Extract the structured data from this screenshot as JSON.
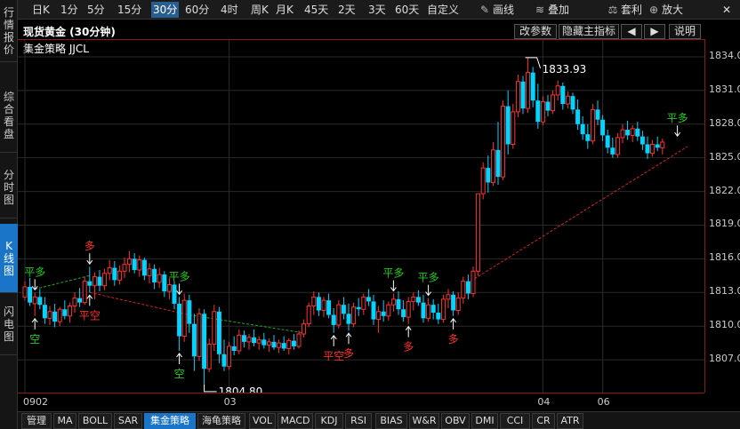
{
  "side_tabs": [
    {
      "label": "行情报价",
      "active": false
    },
    {
      "label": "综合看盘",
      "active": false
    },
    {
      "label": "分时图",
      "active": false
    },
    {
      "label": "K线图",
      "active": true
    },
    {
      "label": "闪电图",
      "active": false
    }
  ],
  "toolbar": {
    "periods": [
      "日K",
      "1分",
      "5分",
      "15分",
      "30分",
      "60分",
      "4时",
      "周K",
      "月K",
      "45天",
      "2天",
      "3天",
      "60天",
      "自定义"
    ],
    "active_period": "30分",
    "actions": [
      {
        "label": "画线",
        "icon": "pencil-icon"
      },
      {
        "label": "叠加",
        "icon": "stack-icon"
      },
      {
        "label": "套利",
        "icon": "arbitrage-icon"
      },
      {
        "label": "放大",
        "icon": "zoom-in-icon"
      }
    ],
    "close": "✕"
  },
  "header": {
    "title": "现货黄金 (30分钟)",
    "indicator": "集金策略 JJCL",
    "buttons": [
      "改参数",
      "隐藏主指标",
      "◀",
      "▶",
      "说明"
    ]
  },
  "chart_data": {
    "type": "candlestick",
    "symbol": "现货黄金",
    "interval": "30分钟",
    "y_ticks": [
      1834.0,
      1831.0,
      1828.0,
      1825.0,
      1822.0,
      1819.0,
      1816.0,
      1813.0,
      1810.0,
      1807.0
    ],
    "ylim": [
      1804.0,
      1835.5
    ],
    "x_labels": [
      {
        "label": "0902",
        "index": 0
      },
      {
        "label": "03",
        "index": 41
      },
      {
        "label": "04",
        "index": 104
      },
      {
        "label": "06",
        "index": 116
      }
    ],
    "annotations": [
      {
        "text": "1833.93",
        "index": 101,
        "value": 1833.93,
        "kind": "high"
      },
      {
        "text": "1804.80",
        "index": 36,
        "value": 1804.8,
        "kind": "low"
      }
    ],
    "signals": [
      {
        "text": "平多",
        "index": 2,
        "dir": "down",
        "color": "green"
      },
      {
        "text": "空",
        "index": 2,
        "dir": "up",
        "color": "green"
      },
      {
        "text": "多",
        "index": 13,
        "dir": "down",
        "color": "red"
      },
      {
        "text": "平空",
        "index": 13,
        "dir": "up",
        "color": "red"
      },
      {
        "text": "平多",
        "index": 31,
        "dir": "down",
        "color": "green"
      },
      {
        "text": "空",
        "index": 31,
        "dir": "up",
        "color": "green"
      },
      {
        "text": "平空",
        "index": 62,
        "dir": "up",
        "color": "red"
      },
      {
        "text": "多",
        "index": 65,
        "dir": "up",
        "color": "red"
      },
      {
        "text": "平多",
        "index": 74,
        "dir": "down",
        "color": "green"
      },
      {
        "text": "多",
        "index": 77,
        "dir": "up",
        "color": "red"
      },
      {
        "text": "平多",
        "index": 81,
        "dir": "down",
        "color": "green"
      },
      {
        "text": "多",
        "index": 86,
        "dir": "up",
        "color": "red"
      },
      {
        "text": "平多",
        "index": 131,
        "dir": "down",
        "color": "green"
      }
    ],
    "candles": [
      [
        1812.6,
        1814.0,
        1812.3,
        1813.5
      ],
      [
        1813.5,
        1814.3,
        1811.8,
        1812.1
      ],
      [
        1812.0,
        1813.0,
        1810.9,
        1812.6
      ],
      [
        1812.6,
        1813.3,
        1811.5,
        1811.9
      ],
      [
        1811.9,
        1812.6,
        1810.2,
        1810.7
      ],
      [
        1810.7,
        1811.8,
        1810.1,
        1811.3
      ],
      [
        1811.3,
        1812.0,
        1809.9,
        1810.4
      ],
      [
        1810.4,
        1811.7,
        1810.0,
        1811.5
      ],
      [
        1811.5,
        1812.3,
        1810.6,
        1810.9
      ],
      [
        1810.9,
        1812.1,
        1810.3,
        1811.8
      ],
      [
        1811.8,
        1813.0,
        1811.2,
        1812.5
      ],
      [
        1812.5,
        1813.4,
        1811.7,
        1812.1
      ],
      [
        1812.1,
        1814.4,
        1811.9,
        1814.0
      ],
      [
        1814.0,
        1815.3,
        1813.0,
        1813.6
      ],
      [
        1813.6,
        1814.8,
        1812.4,
        1814.4
      ],
      [
        1814.4,
        1815.0,
        1813.1,
        1813.6
      ],
      [
        1813.6,
        1815.1,
        1813.2,
        1814.7
      ],
      [
        1814.7,
        1815.9,
        1814.1,
        1815.2
      ],
      [
        1815.2,
        1815.8,
        1813.6,
        1814.1
      ],
      [
        1814.1,
        1815.4,
        1813.7,
        1814.9
      ],
      [
        1814.9,
        1816.1,
        1814.3,
        1815.5
      ],
      [
        1815.5,
        1816.7,
        1814.8,
        1816.0
      ],
      [
        1816.0,
        1816.5,
        1814.7,
        1815.0
      ],
      [
        1815.0,
        1816.3,
        1814.4,
        1815.9
      ],
      [
        1815.9,
        1816.1,
        1814.1,
        1814.5
      ],
      [
        1814.5,
        1815.6,
        1813.8,
        1815.1
      ],
      [
        1815.1,
        1815.5,
        1813.3,
        1813.9
      ],
      [
        1813.9,
        1815.2,
        1813.4,
        1814.6
      ],
      [
        1814.6,
        1814.9,
        1812.6,
        1813.1
      ],
      [
        1813.1,
        1814.3,
        1812.4,
        1813.7
      ],
      [
        1813.7,
        1814.0,
        1811.5,
        1812.0
      ],
      [
        1812.0,
        1812.6,
        1807.8,
        1809.1
      ],
      [
        1809.1,
        1812.9,
        1808.6,
        1812.3
      ],
      [
        1812.3,
        1812.8,
        1809.4,
        1810.2
      ],
      [
        1810.2,
        1811.1,
        1806.0,
        1807.3
      ],
      [
        1807.3,
        1811.6,
        1806.9,
        1811.1
      ],
      [
        1811.1,
        1811.5,
        1804.8,
        1806.2
      ],
      [
        1806.2,
        1808.9,
        1805.9,
        1808.4
      ],
      [
        1808.4,
        1811.9,
        1807.8,
        1811.3
      ],
      [
        1811.3,
        1811.7,
        1806.7,
        1807.5
      ],
      [
        1807.5,
        1808.8,
        1806.0,
        1806.4
      ],
      [
        1806.4,
        1808.6,
        1806.1,
        1808.2
      ],
      [
        1808.2,
        1809.1,
        1807.4,
        1807.8
      ],
      [
        1807.8,
        1809.7,
        1807.5,
        1809.2
      ],
      [
        1809.2,
        1809.6,
        1808.1,
        1808.6
      ],
      [
        1808.6,
        1809.3,
        1807.9,
        1809.0
      ],
      [
        1809.0,
        1809.7,
        1808.2,
        1808.5
      ],
      [
        1808.5,
        1809.1,
        1807.9,
        1808.8
      ],
      [
        1808.8,
        1809.4,
        1808.0,
        1808.3
      ],
      [
        1808.3,
        1808.9,
        1807.7,
        1808.6
      ],
      [
        1808.6,
        1809.2,
        1807.9,
        1808.1
      ],
      [
        1808.1,
        1808.8,
        1807.6,
        1808.5
      ],
      [
        1808.5,
        1809.1,
        1807.8,
        1808.0
      ],
      [
        1808.0,
        1808.9,
        1807.5,
        1808.7
      ],
      [
        1808.7,
        1809.3,
        1807.9,
        1808.2
      ],
      [
        1808.2,
        1809.6,
        1808.0,
        1809.3
      ],
      [
        1809.3,
        1810.6,
        1809.0,
        1810.2
      ],
      [
        1810.2,
        1812.1,
        1809.9,
        1811.8
      ],
      [
        1811.8,
        1813.1,
        1811.0,
        1812.6
      ],
      [
        1812.6,
        1813.0,
        1810.9,
        1811.4
      ],
      [
        1811.4,
        1812.6,
        1810.8,
        1812.3
      ],
      [
        1812.3,
        1812.9,
        1810.7,
        1811.0
      ],
      [
        1811.0,
        1811.6,
        1809.4,
        1810.1
      ],
      [
        1810.1,
        1812.3,
        1809.8,
        1811.9
      ],
      [
        1811.9,
        1812.6,
        1810.6,
        1811.1
      ],
      [
        1811.1,
        1812.0,
        1809.6,
        1810.2
      ],
      [
        1810.2,
        1812.1,
        1809.9,
        1811.7
      ],
      [
        1811.7,
        1812.5,
        1810.9,
        1811.5
      ],
      [
        1811.5,
        1812.9,
        1811.0,
        1812.6
      ],
      [
        1812.6,
        1813.3,
        1811.8,
        1812.2
      ],
      [
        1812.2,
        1812.8,
        1810.1,
        1810.6
      ],
      [
        1810.6,
        1811.8,
        1809.4,
        1811.3
      ],
      [
        1811.3,
        1812.3,
        1810.4,
        1810.9
      ],
      [
        1810.9,
        1812.2,
        1810.5,
        1811.9
      ],
      [
        1811.9,
        1812.9,
        1811.3,
        1812.4
      ],
      [
        1812.4,
        1813.1,
        1811.0,
        1811.5
      ],
      [
        1811.5,
        1812.3,
        1810.4,
        1810.8
      ],
      [
        1810.8,
        1812.6,
        1810.2,
        1812.2
      ],
      [
        1812.2,
        1813.0,
        1811.4,
        1812.6
      ],
      [
        1812.6,
        1813.2,
        1811.8,
        1812.1
      ],
      [
        1812.1,
        1812.8,
        1810.3,
        1810.7
      ],
      [
        1810.7,
        1812.5,
        1810.4,
        1811.9
      ],
      [
        1811.9,
        1812.4,
        1810.6,
        1811.2
      ],
      [
        1811.2,
        1812.0,
        1810.2,
        1810.6
      ],
      [
        1810.6,
        1812.8,
        1810.3,
        1812.4
      ],
      [
        1812.4,
        1813.3,
        1811.6,
        1812.8
      ],
      [
        1812.8,
        1813.1,
        1810.9,
        1811.4
      ],
      [
        1811.4,
        1813.0,
        1811.0,
        1812.5
      ],
      [
        1812.5,
        1814.4,
        1812.0,
        1814.0
      ],
      [
        1814.0,
        1814.6,
        1812.4,
        1812.9
      ],
      [
        1812.9,
        1815.3,
        1812.6,
        1814.9
      ],
      [
        1814.9,
        1819.0,
        1814.5,
        1821.8
      ],
      [
        1821.8,
        1824.6,
        1821.3,
        1824.1
      ],
      [
        1824.1,
        1825.2,
        1821.9,
        1822.8
      ],
      [
        1822.8,
        1826.4,
        1822.5,
        1825.7
      ],
      [
        1825.7,
        1828.2,
        1822.6,
        1823.3
      ],
      [
        1823.3,
        1830.1,
        1823.0,
        1829.6
      ],
      [
        1829.6,
        1831.0,
        1825.3,
        1826.2
      ],
      [
        1826.2,
        1829.8,
        1825.8,
        1829.1
      ],
      [
        1829.1,
        1832.4,
        1828.6,
        1831.8
      ],
      [
        1831.8,
        1832.3,
        1828.9,
        1829.4
      ],
      [
        1829.4,
        1833.93,
        1829.0,
        1832.6
      ],
      [
        1832.6,
        1833.1,
        1829.5,
        1830.1
      ],
      [
        1830.1,
        1831.6,
        1827.6,
        1828.2
      ],
      [
        1828.2,
        1830.5,
        1827.9,
        1830.0
      ],
      [
        1830.0,
        1830.6,
        1828.7,
        1829.2
      ],
      [
        1829.2,
        1831.0,
        1828.9,
        1830.6
      ],
      [
        1830.6,
        1831.9,
        1830.1,
        1831.4
      ],
      [
        1831.4,
        1831.7,
        1829.3,
        1829.8
      ],
      [
        1829.8,
        1830.9,
        1829.4,
        1830.5
      ],
      [
        1830.5,
        1830.8,
        1828.9,
        1829.3
      ],
      [
        1829.3,
        1830.2,
        1827.5,
        1828.0
      ],
      [
        1828.0,
        1828.7,
        1826.6,
        1827.1
      ],
      [
        1827.1,
        1828.0,
        1825.8,
        1826.5
      ],
      [
        1826.5,
        1829.8,
        1826.2,
        1829.3
      ],
      [
        1829.3,
        1830.1,
        1827.9,
        1828.4
      ],
      [
        1828.4,
        1828.8,
        1826.5,
        1827.0
      ],
      [
        1827.0,
        1827.5,
        1825.4,
        1825.9
      ],
      [
        1825.9,
        1826.8,
        1825.0,
        1825.3
      ],
      [
        1825.3,
        1827.2,
        1825.0,
        1826.8
      ],
      [
        1826.8,
        1828.0,
        1826.3,
        1827.5
      ],
      [
        1827.5,
        1828.3,
        1826.6,
        1827.0
      ],
      [
        1827.0,
        1827.9,
        1826.4,
        1827.6
      ],
      [
        1827.6,
        1828.2,
        1826.5,
        1826.9
      ],
      [
        1826.9,
        1827.4,
        1825.7,
        1826.2
      ],
      [
        1826.2,
        1826.9,
        1824.9,
        1825.4
      ],
      [
        1825.4,
        1826.6,
        1825.1,
        1826.2
      ],
      [
        1826.2,
        1826.9,
        1825.6,
        1825.9
      ],
      [
        1825.9,
        1826.7,
        1825.3,
        1826.4
      ]
    ],
    "lines": [
      {
        "color": "#22aa22",
        "style": "dashed",
        "points": [
          [
            2,
            1813.3
          ],
          [
            13,
            1814.5
          ]
        ]
      },
      {
        "color": "#dd2222",
        "style": "dashed",
        "points": [
          [
            13,
            1813.0
          ],
          [
            33,
            1811.0
          ]
        ]
      },
      {
        "color": "#22aa22",
        "style": "dashed",
        "points": [
          [
            33,
            1811.0
          ],
          [
            56,
            1809.4
          ]
        ]
      },
      {
        "color": "#dd2222",
        "style": "dashed",
        "points": [
          [
            88,
            1813.6
          ],
          [
            133,
            1826.0
          ]
        ]
      }
    ]
  },
  "bottom_tabs": [
    {
      "label": "管理",
      "active": false
    },
    {
      "label": "MA",
      "active": false
    },
    {
      "label": "BOLL",
      "active": false
    },
    {
      "label": "SAR",
      "active": false
    },
    {
      "label": "集金策略",
      "active": true
    },
    {
      "label": "海龟策略",
      "active": false
    },
    {
      "label": "VOL",
      "active": false
    },
    {
      "label": "MACD",
      "active": false
    },
    {
      "label": "KDJ",
      "active": false
    },
    {
      "label": "RSI",
      "active": false
    },
    {
      "label": "BIAS",
      "active": false
    },
    {
      "label": "W&R",
      "active": false
    },
    {
      "label": "OBV",
      "active": false
    },
    {
      "label": "DMI",
      "active": false
    },
    {
      "label": "CCI",
      "active": false
    },
    {
      "label": "CR",
      "active": false
    },
    {
      "label": "ATR",
      "active": false
    }
  ]
}
